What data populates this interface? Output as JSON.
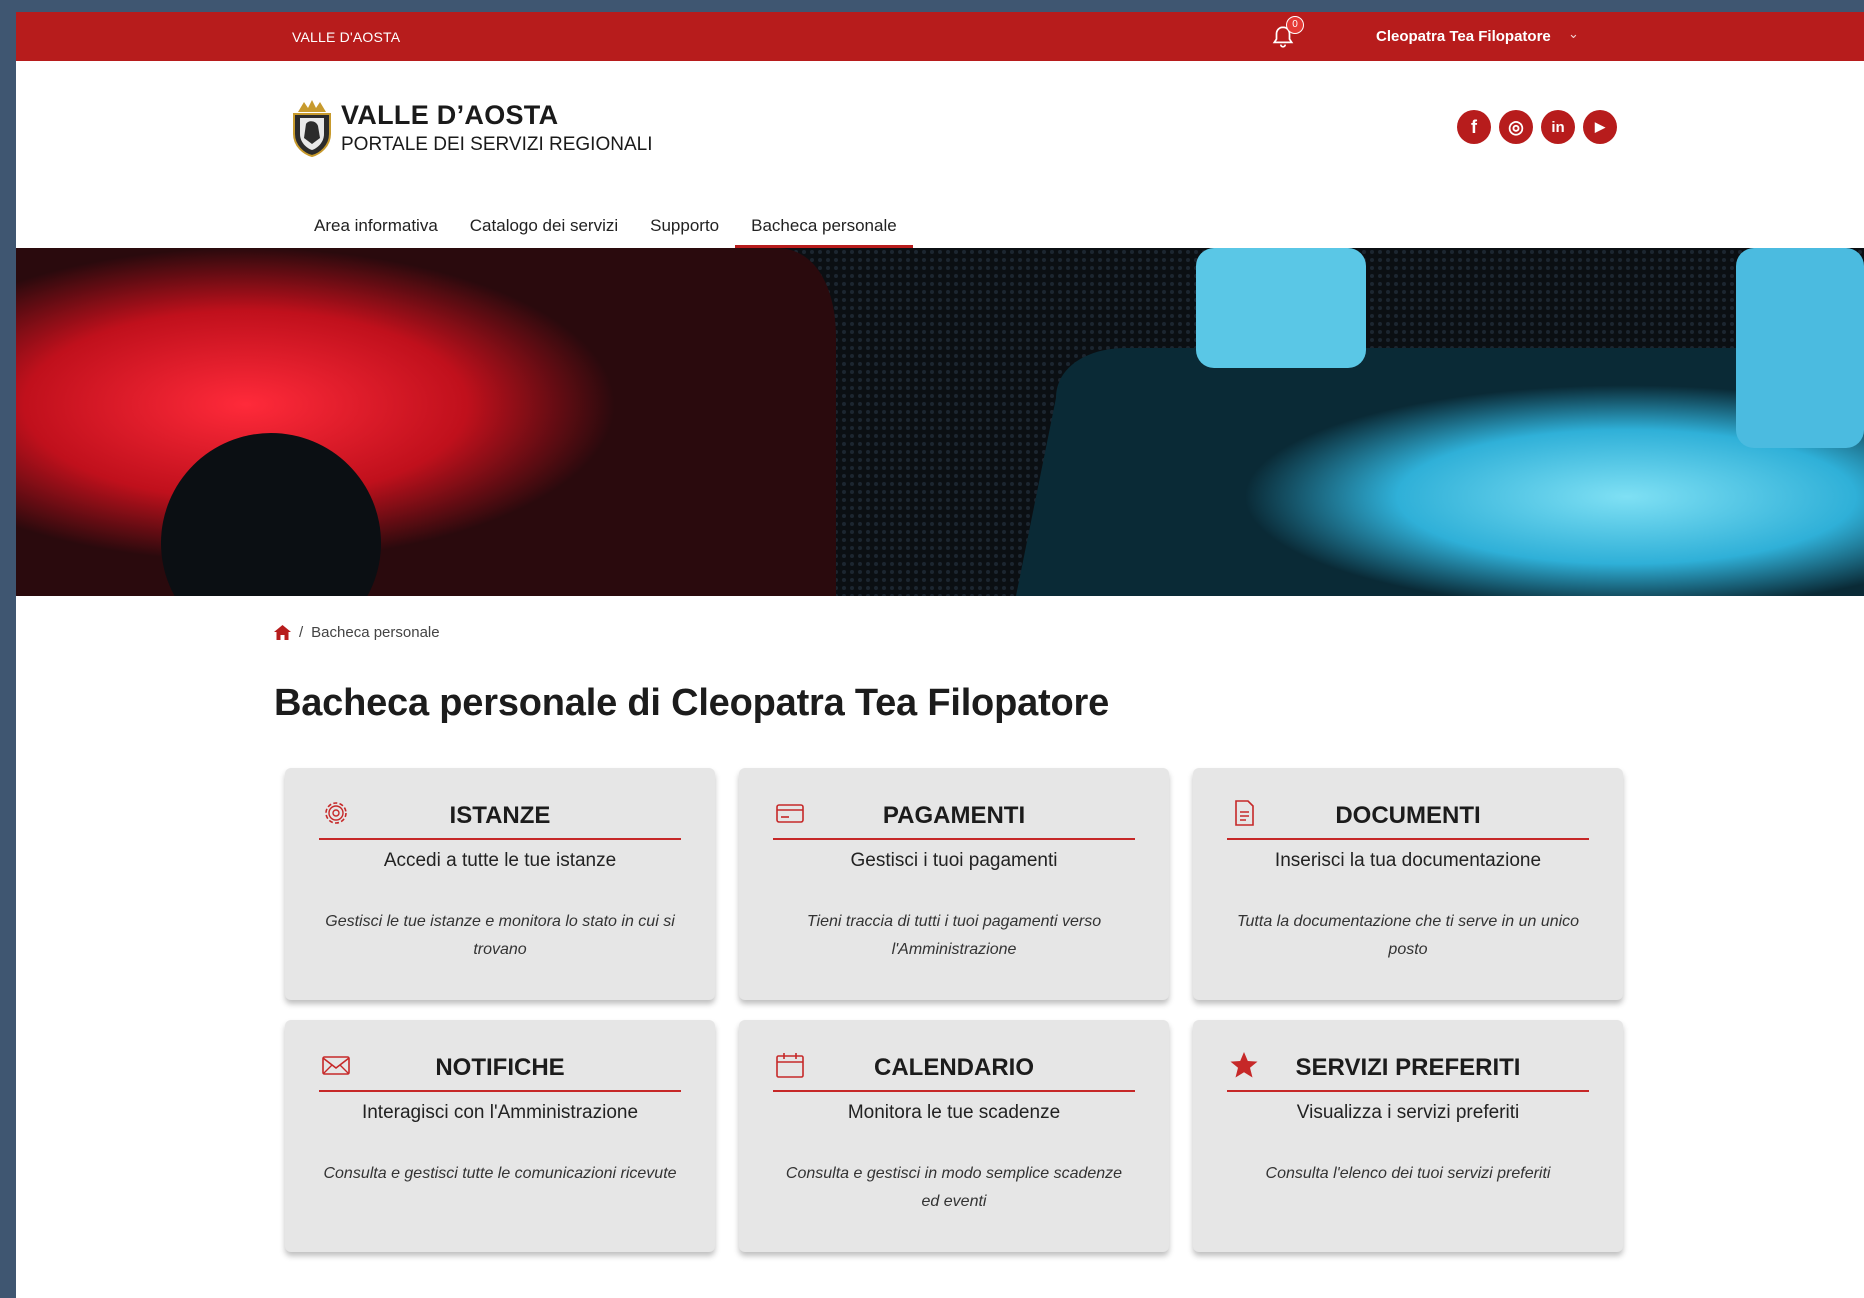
{
  "topbar": {
    "region": "VALLE D'AOSTA",
    "notifications_count": "0",
    "user_name": "Cleopatra Tea Filopatore",
    "user_chevron": "⌄"
  },
  "header": {
    "title": "VALLE D’AOSTA",
    "subtitle": "PORTALE DEI SERVIZI REGIONALI",
    "socials": [
      {
        "icon": "facebook-icon",
        "glyph": "f"
      },
      {
        "icon": "instagram-icon",
        "glyph": "◎"
      },
      {
        "icon": "linkedin-icon",
        "glyph": "in"
      },
      {
        "icon": "youtube-icon",
        "glyph": "▶"
      }
    ]
  },
  "nav": {
    "items": [
      {
        "label": "Area informativa"
      },
      {
        "label": "Catalogo dei servizi"
      },
      {
        "label": "Supporto"
      },
      {
        "label": "Bacheca personale",
        "active": true
      }
    ]
  },
  "breadcrumb": {
    "separator": "/",
    "current": "Bacheca personale"
  },
  "main": {
    "title": "Bacheca personale di Cleopatra Tea Filopatore",
    "cards": [
      {
        "icon": "gear-icon",
        "title": "ISTANZE",
        "subtitle": "Accedi a tutte le tue istanze",
        "description": "Gestisci le tue istanze e monitora lo stato in cui si trovano"
      },
      {
        "icon": "credit-card-icon",
        "title": "PAGAMENTI",
        "subtitle": "Gestisci i tuoi pagamenti",
        "description": "Tieni traccia di tutti i tuoi pagamenti verso l'Amministrazione"
      },
      {
        "icon": "document-icon",
        "title": "DOCUMENTI",
        "subtitle": "Inserisci la tua documentazione",
        "description": "Tutta la documentazione che ti serve in un unico posto"
      },
      {
        "icon": "envelope-icon",
        "title": "NOTIFICHE",
        "subtitle": "Interagisci con l'Amministrazione",
        "description": "Consulta e gestisci tutte le comunicazioni ricevute"
      },
      {
        "icon": "calendar-icon",
        "title": "CALENDARIO",
        "subtitle": "Monitora le tue scadenze",
        "description": "Consulta e gestisci in modo semplice scadenze ed eventi"
      },
      {
        "icon": "star-icon",
        "title": "SERVIZI PREFERITI",
        "subtitle": "Visualizza i servizi preferiti",
        "description": "Consulta l'elenco dei tuoi servizi preferiti"
      }
    ]
  },
  "colors": {
    "brand_red": "#b71c1c",
    "card_bg": "#e6e6e6",
    "frame_bg": "#3f5671"
  }
}
